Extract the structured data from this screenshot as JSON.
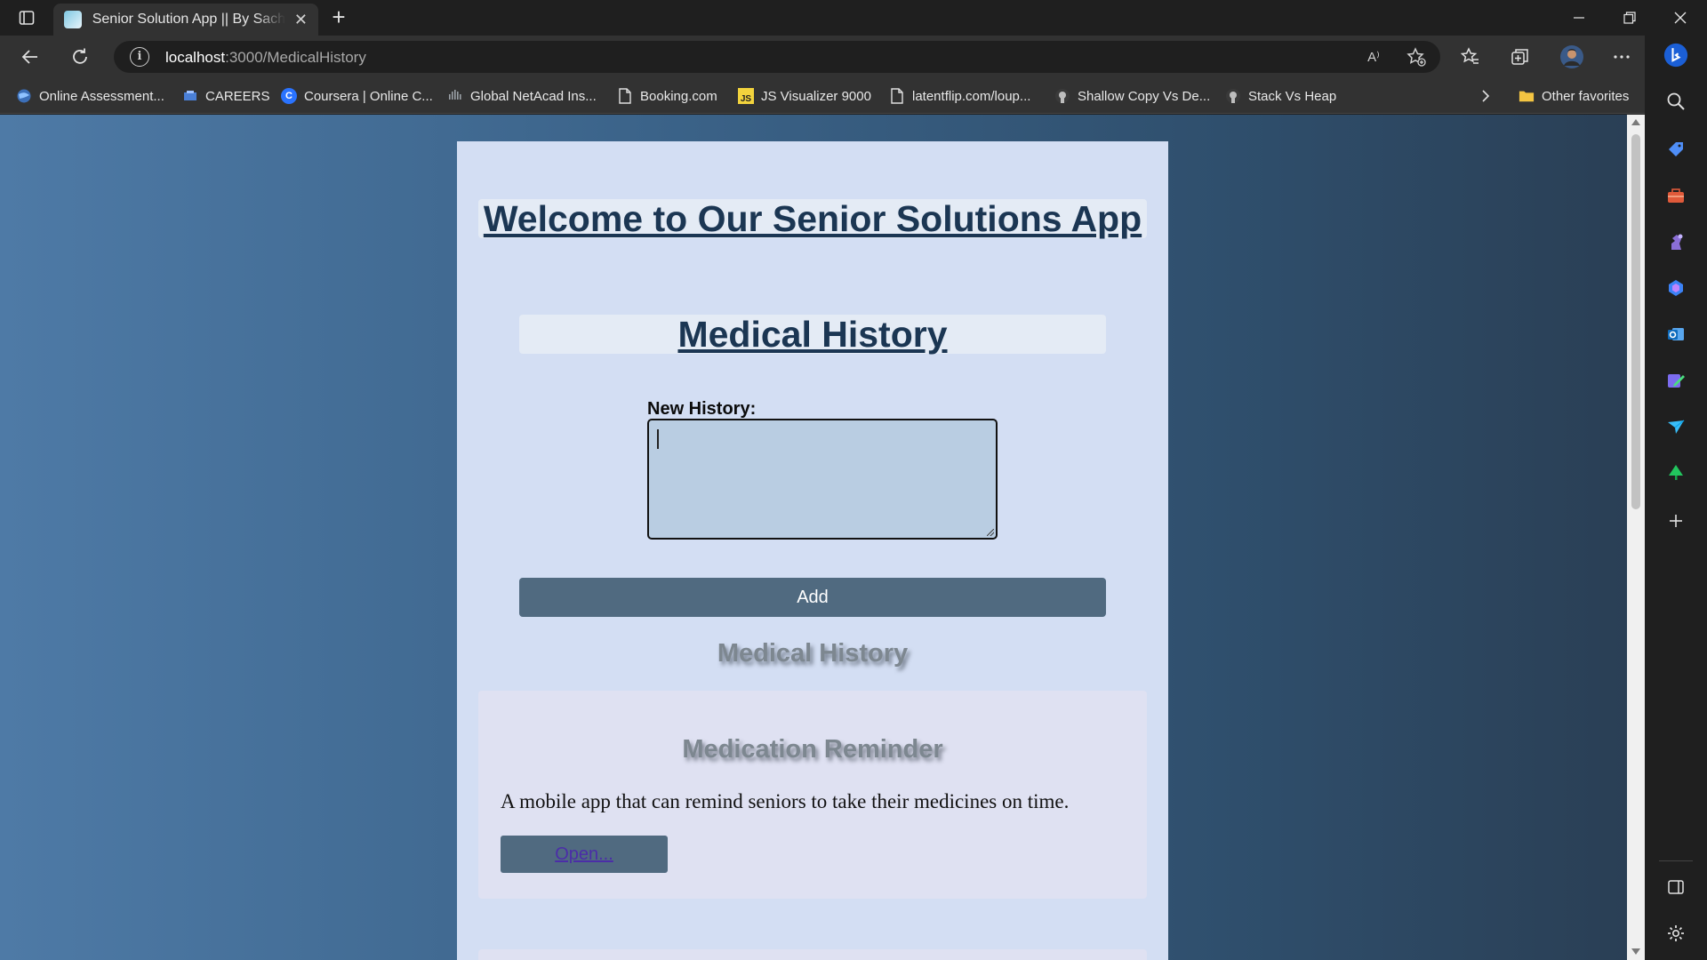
{
  "browser": {
    "tab_title": "Senior Solution App || By Sachin",
    "tab_close": "✕",
    "new_tab": "+",
    "url_host": "localhost",
    "url_path": ":3000/MedicalHistory",
    "info": "i",
    "read_aloud": "A⁾",
    "win_minimize": "—",
    "win_close": "✕"
  },
  "bookmarks": [
    {
      "label": "Online Assessment...",
      "icon": "globe-icon",
      "color": "#5fa8ff"
    },
    {
      "label": "CAREERS",
      "icon": "careers-icon",
      "color": "#4a7fd6"
    },
    {
      "label": "Coursera | Online C...",
      "icon": "coursera-icon",
      "color": "#2a73ff"
    },
    {
      "label": "Global NetAcad Ins...",
      "icon": "netacad-icon",
      "color": "#9aa0a6"
    },
    {
      "label": "Booking.com",
      "icon": "page-icon",
      "color": "#e0e0e0"
    },
    {
      "label": "JS Visualizer 9000",
      "icon": "js-icon",
      "color": "#f2d33d"
    },
    {
      "label": "latentflip.com/loup...",
      "icon": "page-icon",
      "color": "#e0e0e0"
    },
    {
      "label": "Shallow Copy Vs De...",
      "icon": "github-icon",
      "color": "#bdbdbd"
    },
    {
      "label": "Stack Vs Heap",
      "icon": "github-icon",
      "color": "#bdbdbd"
    },
    {
      "label": "Other favorites",
      "icon": "folder-icon",
      "color": "#f4c542"
    }
  ],
  "bookmark_icons": {
    "js": "JS",
    "coursera": "C"
  },
  "app": {
    "title": "Welcome to Our Senior Solutions App",
    "section_title": "Medical History",
    "new_history_label": "New History:",
    "textarea_value": "",
    "add_label": "Add",
    "history_heading": "Medical History",
    "cards": [
      {
        "title": "Medication Reminder",
        "description": "A mobile app that can remind seniors to take their medicines on time.",
        "link_label": "Open..."
      }
    ]
  },
  "colors": {
    "panel": "#d3def3",
    "button": "#506a80",
    "heading": "#1b3653"
  }
}
